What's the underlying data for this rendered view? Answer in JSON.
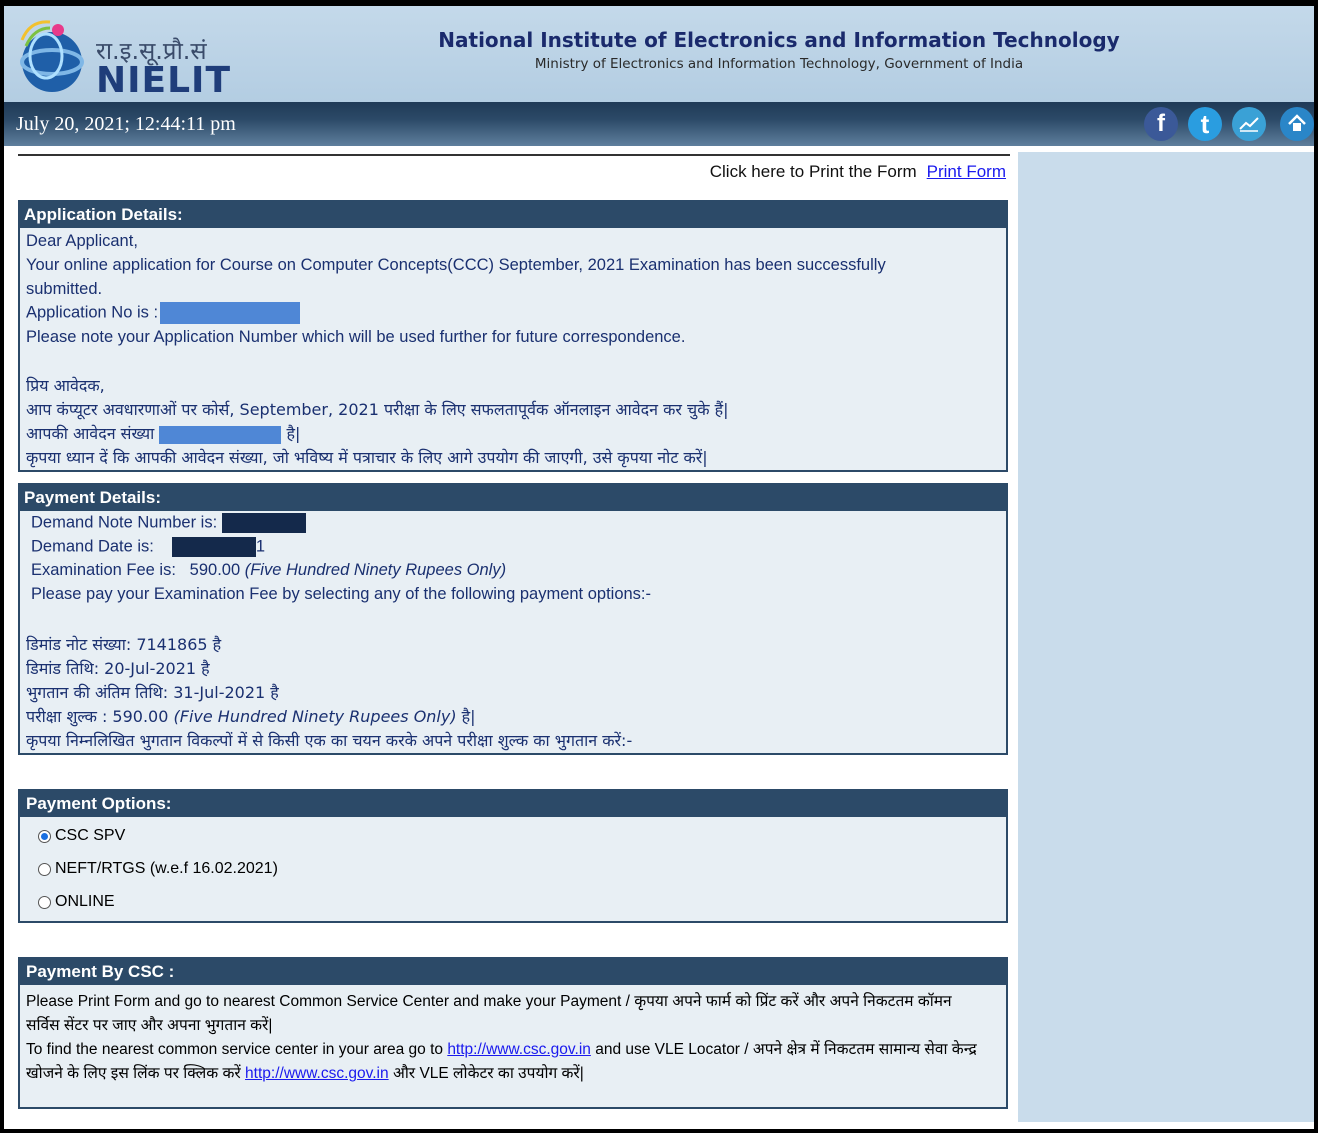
{
  "header": {
    "logo_hindi": "रा.इ.सू.प्रौ.सं",
    "logo_text": "NIELIT",
    "title": "National Institute of Electronics and Information Technology",
    "subtitle": "Ministry of Electronics and Information Technology, Government of India"
  },
  "datebar": {
    "datetime": "July 20, 2021; 12:44:11 pm",
    "icons": [
      {
        "name": "facebook-icon",
        "glyph": "f",
        "color": "#3b5998"
      },
      {
        "name": "twitter-icon",
        "glyph": "t",
        "color": "#2a9de0"
      },
      {
        "name": "chart-icon",
        "glyph": "",
        "color": "#3aa1d6"
      },
      {
        "name": "home-icon",
        "glyph": "",
        "color": "#2a86c8"
      }
    ]
  },
  "print": {
    "text": "Click here to Print the Form",
    "link": "Print Form"
  },
  "application": {
    "heading": "Application Details:",
    "l1": "Dear Applicant,",
    "l2": "Your online application for Course on Computer Concepts(CCC) September, 2021 Examination  has been successfully",
    "l3": "submitted.",
    "l4": "Application No is :",
    "l5": "Please note your Application Number which will be used further for future correspondence.",
    "h1": "प्रिय आवेदक,",
    "h2": "आप कंप्यूटर अवधारणाओं पर कोर्स, September, 2021 परीक्षा के लिए सफलतापूर्वक ऑनलाइन आवेदन कर चुके हैं|",
    "h3a": "आपकी आवेदन संख्या",
    "h3b": "है|",
    "h4": "कृपया ध्यान दें कि आपकी आवेदन संख्या, जो भविष्य में पत्राचार के लिए आगे उपयोग की जाएगी, उसे कृपया नोट करें|"
  },
  "payment": {
    "heading": "Payment Details:",
    "dn_label": "Demand Note Number is:",
    "dd_label": "Demand Date is:",
    "dd_suffix": "1",
    "fee_label": "Examination  Fee is:",
    "fee_value": "590.00",
    "fee_words": "(Five Hundred Ninety Rupees Only)",
    "pay_msg": "Please pay your Examination  Fee by selecting any of the following payment options:-",
    "h_dn": "डिमांड नोट संख्या:  7141865  है",
    "h_dd": "डिमांड तिथि:    20-Jul-2021 है",
    "h_last": "भुगतान की अंतिम तिथि:    31-Jul-2021 है",
    "h_fee_a": "परीक्षा  शुल्क : 590.00",
    "h_fee_b": "(Five Hundred Ninety Rupees Only)",
    "h_fee_c": "है|",
    "h_msg": "कृपया निम्नलिखित भुगतान विकल्पों में से किसी एक का चयन करके अपने परीक्षा  शुल्क का भुगतान करें:-"
  },
  "options": {
    "heading": "Payment Options:",
    "items": [
      {
        "label": "CSC SPV",
        "selected": true
      },
      {
        "label": "NEFT/RTGS (w.e.f 16.02.2021)",
        "selected": false
      },
      {
        "label": "ONLINE",
        "selected": false
      }
    ]
  },
  "csc": {
    "heading": "Payment By CSC :",
    "l1": "Please Print Form and go to nearest Common Service Center and make your Payment / कृपया अपने फार्म को प्रिंट करें और अपने निकटतम कॉमन",
    "l2": "सर्विस सेंटर पर जाए और अपना भुगतान करें|",
    "l3a": "To find the nearest common service center in your area go to",
    "l3link": "http://www.csc.gov.in",
    "l3b": "and use VLE Locator / अपने क्षेत्र में निकटतम सामान्य सेवा केन्द्र",
    "l4a": "खोजने के लिए इस लिंक पर क्लिक करें",
    "l4link": "http://www.csc.gov.in",
    "l4b": "और VLE लोकेटर का उपयोग करें|"
  }
}
